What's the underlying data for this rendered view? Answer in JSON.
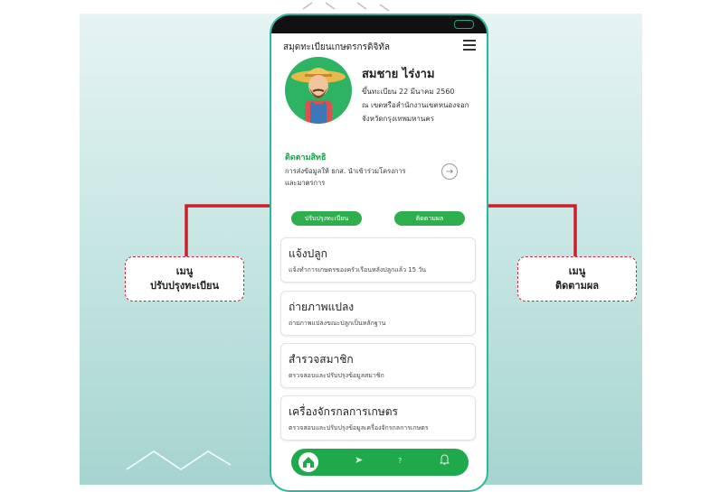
{
  "app": {
    "title": "สมุดทะเบียนเกษตรกรดิจิทัล"
  },
  "profile": {
    "name": "สมชาย  ไร่งาม",
    "registered": "ขึ้นทะเบียน 22 มีนาคม 2560",
    "location_line1": "ณ เขตหรือสำนักงานเขตหนองจอก",
    "location_line2": "จังหวัดกรุงเทพมหานคร"
  },
  "rights": {
    "title": "ติดตามสิทธิ",
    "desc_line1": "การส่งข้อมูลให้ ธกส. นำเข้าร่วมโครงการ",
    "desc_line2": "และมาตรการ"
  },
  "actions": {
    "update_label": "ปรับปรุงทะเบียน",
    "track_label": "ติดตามผล"
  },
  "menu": [
    {
      "title": "แจ้งปลูก",
      "desc": "แจ้งทำการเกษตรของครัวเรือนหลังปลูกแล้ว 15 วัน"
    },
    {
      "title": "ถ่ายภาพแปลง",
      "desc": "ถ่ายภาพแปลงขณะปลูกเป็นหลักฐาน"
    },
    {
      "title": "สำรวจสมาชิก",
      "desc": "ตรวจสอบและปรับปรุงข้อมูลสมาชิก"
    },
    {
      "title": "เครื่องจักรกลการเกษตร",
      "desc": "ตรวจสอบและปรับปรุงข้อมูลเครื่องจักรกลการเกษตร"
    }
  ],
  "callouts": {
    "left_line1": "เมนู",
    "left_line2": "ปรับปรุงทะเบียน",
    "right_line1": "เมนู",
    "right_line2": "ติดตามผล"
  },
  "icons": {
    "menu": "hamburger-icon",
    "arrow": "arrow-right-icon",
    "home": "home-icon",
    "send": "send-icon",
    "help": "question-icon",
    "bell": "bell-icon"
  },
  "colors": {
    "accent_green": "#2eae4d",
    "callout_red": "#c62a3a",
    "phone_border": "#2bb8a0"
  }
}
